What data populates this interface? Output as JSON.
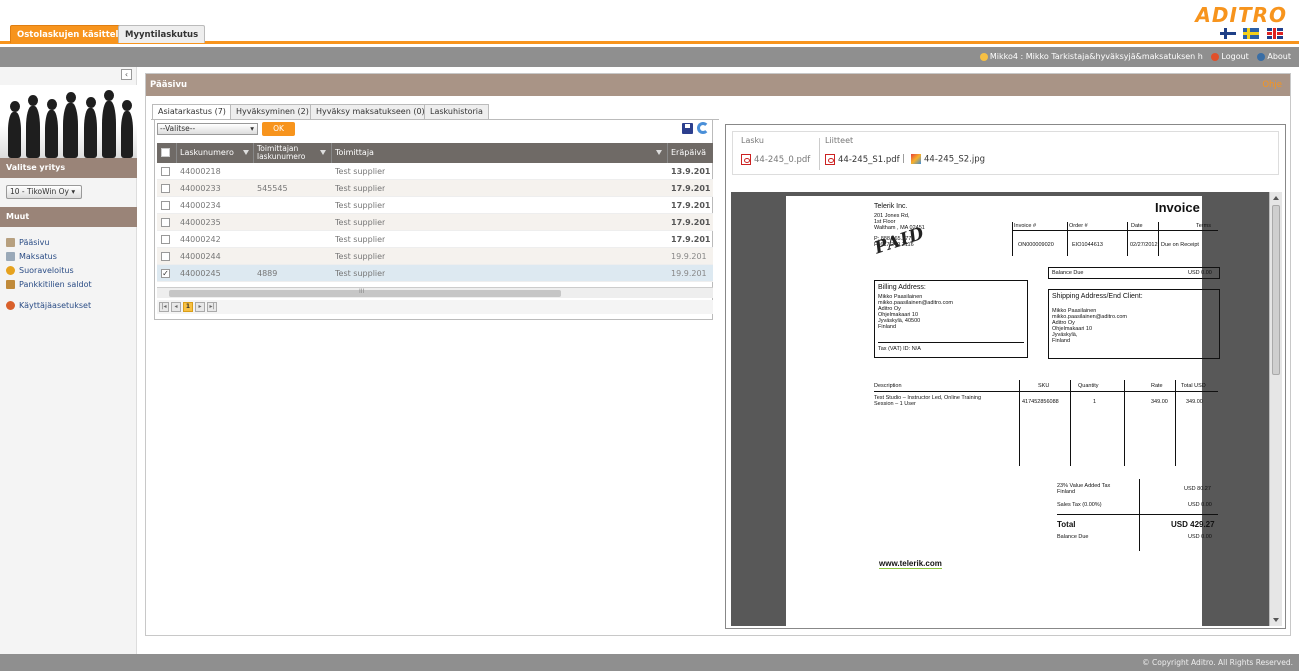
{
  "app_tabs": [
    {
      "label": "Ostolaskujen käsittely"
    },
    {
      "label": "Myyntilaskutus"
    }
  ],
  "brand": {
    "logo_text": "ADITRO",
    "accent_color": "#f7941d"
  },
  "userbar": {
    "user_label": "Mikko4 : Mikko Tarkistaja&hyväksyjä&maksatuksen h",
    "logout_label": "Logout",
    "about_label": "About"
  },
  "sidebar": {
    "select_company_label": "Valitse yritys",
    "company_value": "10 - TikoWin Oy",
    "other_label": "Muut",
    "items": [
      {
        "label": "Pääsivu"
      },
      {
        "label": "Maksatus"
      },
      {
        "label": "Suoraveloitus"
      },
      {
        "label": "Pankkitilien saldot"
      },
      {
        "label": "Käyttäjäasetukset"
      }
    ]
  },
  "main": {
    "title": "Pääsivu",
    "help_label": "Ohje",
    "tabs": [
      {
        "label": "Asiatarkastus (7)"
      },
      {
        "label": "Hyväksyminen (2)"
      },
      {
        "label": "Hyväksy maksatukseen (0)"
      },
      {
        "label": "Laskuhistoria"
      }
    ],
    "action_select": "--Valitse--",
    "ok_label": "OK",
    "columns": {
      "invoice_no": "Laskunumero",
      "supplier_invoice_no_1": "Toimittajan",
      "supplier_invoice_no_2": "laskunumero",
      "supplier": "Toimittaja",
      "due_date": "Eräpäivä"
    },
    "rows": [
      {
        "invoice_no": "44000218",
        "supplier_invoice_no": "",
        "supplier": "Test supplier",
        "due": "13.9.201",
        "checked": ""
      },
      {
        "invoice_no": "44000233",
        "supplier_invoice_no": "545545",
        "supplier": "Test supplier",
        "due": "17.9.201",
        "checked": ""
      },
      {
        "invoice_no": "44000234",
        "supplier_invoice_no": "",
        "supplier": "Test supplier",
        "due": "17.9.201",
        "checked": ""
      },
      {
        "invoice_no": "44000235",
        "supplier_invoice_no": "",
        "supplier": "Test supplier",
        "due": "17.9.201",
        "checked": ""
      },
      {
        "invoice_no": "44000242",
        "supplier_invoice_no": "",
        "supplier": "Test supplier",
        "due": "17.9.201",
        "checked": ""
      },
      {
        "invoice_no": "44000244",
        "supplier_invoice_no": "",
        "supplier": "Test supplier",
        "due": "19.9.201",
        "checked": ""
      },
      {
        "invoice_no": "44000245",
        "supplier_invoice_no": "4889",
        "supplier": "Test supplier",
        "due": "19.9.201",
        "checked": "✓"
      }
    ],
    "pager_current": "1",
    "scroll_grip": "III"
  },
  "preview": {
    "invoice_label": "Lasku",
    "attachments_label": "Liitteet",
    "invoice_file": "44-245_0.pdf",
    "attachment_1": "44-245_S1.pdf",
    "attachment_sep": "|",
    "attachment_2": "44-245_S2.jpg"
  },
  "invoice": {
    "company": "Telerik Inc.",
    "addr1": "201 Jones Rd,",
    "addr2": "1st Floor",
    "addr3": "Waltham , MA 02451",
    "phone": "P: 888.365.2779",
    "fax": "F: 617.249.2116",
    "stamp": "PAID",
    "title": "Invoice",
    "h_invoice": "Invoice #",
    "h_order": "Order #",
    "h_date": "Date",
    "h_terms": "Terms",
    "v_invoice": "ON000009020",
    "v_order": "EIO1044613",
    "v_date": "02/27/2012",
    "v_terms": "Due on Receipt",
    "balance_due_label": "Balance Due",
    "balance_due_value": "USD 0.00",
    "billing_title": "Billing Address:",
    "billing_1": "Mikko Paasilainen",
    "billing_2": "mikko.paasilainen@aditro.com",
    "billing_3": "Aditro Oy",
    "billing_4": "Ohjelmakaari 10",
    "billing_5": "Jyväskylä, 40500",
    "billing_6": "Finland",
    "billing_tax": "Tax (VAT) ID: N/A",
    "shipping_title": "Shipping Address/End Client:",
    "shipping_1": "Mikko Paasilainen",
    "shipping_2": "mikko.paasilainen@aditro.com",
    "shipping_3": "Aditro Oy",
    "shipping_4": "Ohjelmakaari 10",
    "shipping_5": "Jyväskylä,",
    "shipping_6": "Finland",
    "col_desc": "Description",
    "col_sku": "SKU",
    "col_qty": "Quantity",
    "col_rate": "Rate",
    "col_total": "Total USD",
    "item_desc_1": "Test Studio – Instructor Led, Online Training",
    "item_desc_2": "Session – 1 User",
    "item_sku": "417452856088",
    "item_qty": "1",
    "item_rate": "349.00",
    "item_total": "349.00",
    "vat_label_1": "23% Value Added Tax",
    "vat_label_2": "Finland",
    "vat_value": "USD 80.27",
    "sales_tax_label": "Sales Tax (0.00%)",
    "sales_tax_value": "USD 0.00",
    "total_label": "Total",
    "total_value": "USD 429.27",
    "balance_label": "Balance Due",
    "balance_value": "USD 0.00",
    "website": "www.telerik.com"
  },
  "footer": {
    "copyright": "© Copyright Aditro. All Rights Reserved."
  }
}
